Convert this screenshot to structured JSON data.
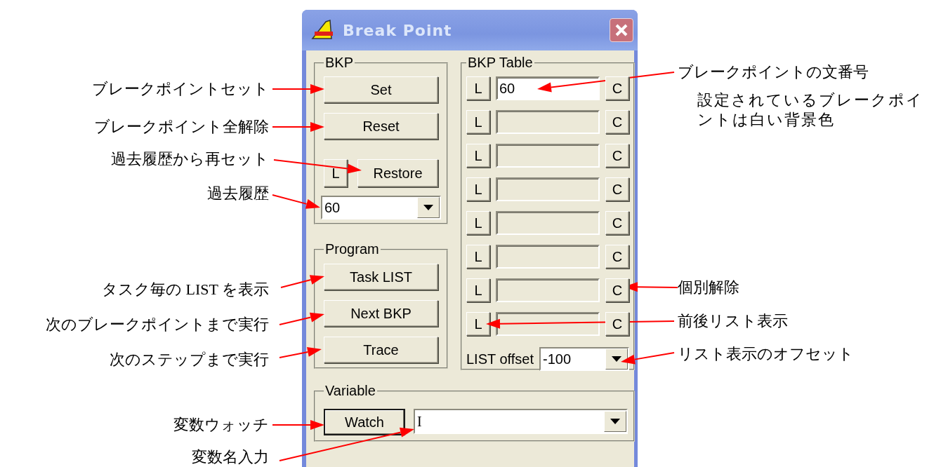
{
  "window": {
    "title": "Break Point"
  },
  "bkp": {
    "title": "BKP",
    "buttons": [
      "Set",
      "Reset"
    ],
    "list_button": "L",
    "restore_button": "Restore",
    "history": {
      "value": "60"
    }
  },
  "program": {
    "title": "Program",
    "buttons": [
      "Task LIST",
      "Next BKP",
      "Trace"
    ]
  },
  "bkp_table": {
    "title": "BKP Table",
    "rows": [
      {
        "list_button": "L",
        "value": "60",
        "active": true,
        "clear_button": "C"
      },
      {
        "list_button": "L",
        "active": false,
        "clear_button": "C"
      },
      {
        "list_button": "L",
        "active": false,
        "clear_button": "C"
      },
      {
        "list_button": "L",
        "active": false,
        "clear_button": "C"
      },
      {
        "list_button": "L",
        "active": false,
        "clear_button": "C"
      },
      {
        "list_button": "L",
        "active": false,
        "clear_button": "C"
      },
      {
        "list_button": "L",
        "active": false,
        "clear_button": "C"
      },
      {
        "list_button": "L",
        "active": false,
        "clear_button": "C"
      }
    ],
    "offset_label": "LIST offset",
    "offset": {
      "value": "-100"
    }
  },
  "variable": {
    "title": "Variable",
    "watch_button": {
      "label": "Watch",
      "default": true
    },
    "name_field": {
      "value": "I"
    }
  },
  "annotations_left": [
    "ブレークポイントセット",
    "ブレークポイント全解除",
    "過去履歴から再セット",
    "過去履歴",
    "タスク毎の LIST を表示",
    "次のブレークポイントまで実行",
    "次のステップまで実行",
    "変数ウォッチ",
    "変数名入力"
  ],
  "annotations_right": [
    "ブレークポイントの文番号",
    "設定されているブレークポイントは白い背景色",
    "個別解除",
    "前後リスト表示",
    "リスト表示のオフセット"
  ]
}
